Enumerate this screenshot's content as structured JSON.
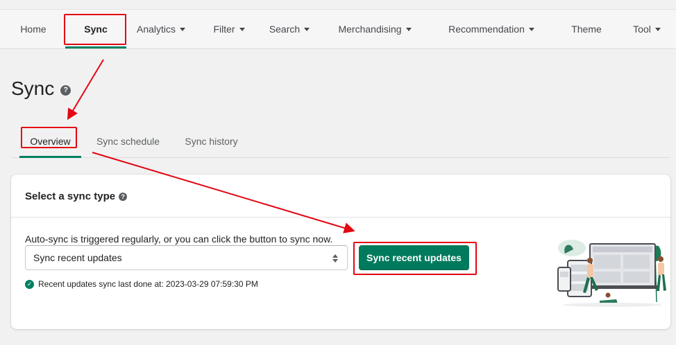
{
  "nav": {
    "items": [
      {
        "label": "Home",
        "dropdown": false
      },
      {
        "label": "Sync",
        "dropdown": false,
        "active": true
      },
      {
        "label": "Analytics",
        "dropdown": true
      },
      {
        "label": "Filter",
        "dropdown": true
      },
      {
        "label": "Search",
        "dropdown": true
      },
      {
        "label": "Merchandising",
        "dropdown": true
      },
      {
        "label": "Recommendation",
        "dropdown": true
      },
      {
        "label": "Theme",
        "dropdown": false
      },
      {
        "label": "Tool",
        "dropdown": true
      }
    ]
  },
  "page": {
    "title": "Sync",
    "help_icon": "?"
  },
  "tabs": [
    {
      "label": "Overview",
      "active": true
    },
    {
      "label": "Sync schedule",
      "active": false
    },
    {
      "label": "Sync history",
      "active": false
    }
  ],
  "card": {
    "title": "Select a sync type",
    "help_icon": "?",
    "description": "Auto-sync is triggered regularly, or you can click the button to sync now.",
    "select": {
      "value": "Sync recent updates"
    },
    "button_label": "Sync recent updates",
    "status_text": "Recent updates sync last done at: 2023-03-29 07:59:30 PM",
    "status_icon": "✓"
  },
  "colors": {
    "accent_green": "#008060",
    "button_green": "#007a5c",
    "annotation_red": "#e30613"
  }
}
